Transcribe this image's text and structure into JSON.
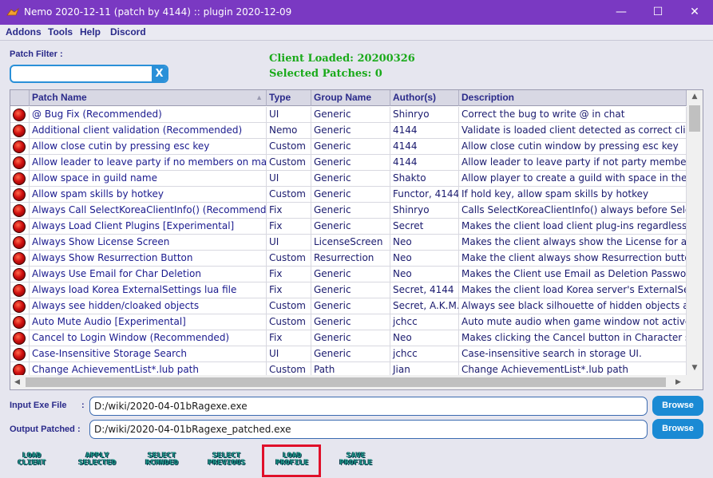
{
  "window": {
    "title": "Nemo 2020-12-11 (patch by 4144) :: plugin 2020-12-09",
    "minimize": "—",
    "maximize": "☐",
    "close": "✕"
  },
  "menu": [
    "Addons",
    "Tools",
    "Help",
    "Discord"
  ],
  "filter": {
    "label": "Patch Filter :",
    "value": "",
    "clear_icon": "X"
  },
  "status": {
    "client_loaded": "Client Loaded: 20200326",
    "selected_patches": "Selected Patches: 0"
  },
  "grid": {
    "columns": [
      "Patch Name",
      "Type",
      "Group Name",
      "Author(s)",
      "Description"
    ],
    "rows": [
      [
        "@ Bug Fix (Recommended)",
        "UI",
        "Generic",
        "Shinryo",
        "Correct the bug to write @ in chat"
      ],
      [
        "Additional client validation (Recommended)",
        "Nemo",
        "Generic",
        "4144",
        "Validate is loaded client detected as correct client."
      ],
      [
        "Allow close cutin by pressing esc key",
        "Custom",
        "Generic",
        "4144",
        "Allow close cutin window by pressing esc key"
      ],
      [
        "Allow leader to leave party if no members on map",
        "Custom",
        "Generic",
        "4144",
        "Allow leader to leave party if not party members o"
      ],
      [
        "Allow space in guild name",
        "UI",
        "Generic",
        "Shakto",
        "Allow player to create a guild with space in the nam"
      ],
      [
        "Allow spam skills by hotkey",
        "Custom",
        "Generic",
        "Functor, 4144",
        "If hold key, allow spam skills by hotkey"
      ],
      [
        "Always Call SelectKoreaClientInfo() (Recommended)",
        "Fix",
        "Generic",
        "Shinryo",
        "Calls SelectKoreaClientInfo() always before SelectC"
      ],
      [
        "Always Load Client Plugins [Experimental]",
        "Fix",
        "Generic",
        "Secret",
        "Makes the client load client plug-ins regardless of i"
      ],
      [
        "Always Show License Screen",
        "UI",
        "LicenseScreen",
        "Neo",
        "Makes the client always show the License for all Lan"
      ],
      [
        "Always Show Resurrection Button",
        "Custom",
        "Resurrection",
        "Neo",
        "Make the client always show Resurrection button w"
      ],
      [
        "Always Use Email for Char Deletion",
        "Fix",
        "Generic",
        "Neo",
        "Makes the Client use Email as Deletion Password fo"
      ],
      [
        "Always load Korea ExternalSettings lua file",
        "Fix",
        "Generic",
        "Secret, 4144",
        "Makes the client load Korea server's ExternalSettin"
      ],
      [
        "Always see hidden/cloaked objects",
        "Custom",
        "Generic",
        "Secret, A.K.M.",
        "Always see black silhouette of hidden objects as if t"
      ],
      [
        "Auto Mute Audio [Experimental]",
        "Custom",
        "Generic",
        "jchcc",
        "Auto mute audio when game window not actived."
      ],
      [
        "Cancel to Login Window (Recommended)",
        "Fix",
        "Generic",
        "Neo",
        "Makes clicking the Cancel button in Character selec"
      ],
      [
        "Case-Insensitive Storage Search",
        "UI",
        "Generic",
        "jchcc",
        "Case-insensitive search in storage UI."
      ],
      [
        "Change AchievementList*.lub path",
        "Custom",
        "Path",
        "Jian",
        "Change AchievementList*.lub path"
      ]
    ]
  },
  "input_exe": {
    "label": "Input Exe File",
    "colon": ":",
    "value": "D:/wiki/2020-04-01bRagexe.exe",
    "browse": "Browse"
  },
  "output_exe": {
    "label": "Output Patched :",
    "value": "D:/wiki/2020-04-01bRagexe_patched.exe",
    "browse": "Browse"
  },
  "toolbar": [
    {
      "line1": "LOAD",
      "line2": "CLIENT"
    },
    {
      "line1": "APPLY",
      "line2": "SELECTED"
    },
    {
      "line1": "SELECT",
      "line2": "RCMNDED"
    },
    {
      "line1": "SELECT",
      "line2": "PREVIOUS"
    },
    {
      "line1": "LOAD",
      "line2": "PROFILE"
    },
    {
      "line1": "SAVE",
      "line2": "PROFILE"
    }
  ],
  "colors": {
    "titlebar": "#7a39c2",
    "accent": "#1a8ad4",
    "status_green": "#1aaa1a",
    "highlight": "#e0102a"
  }
}
